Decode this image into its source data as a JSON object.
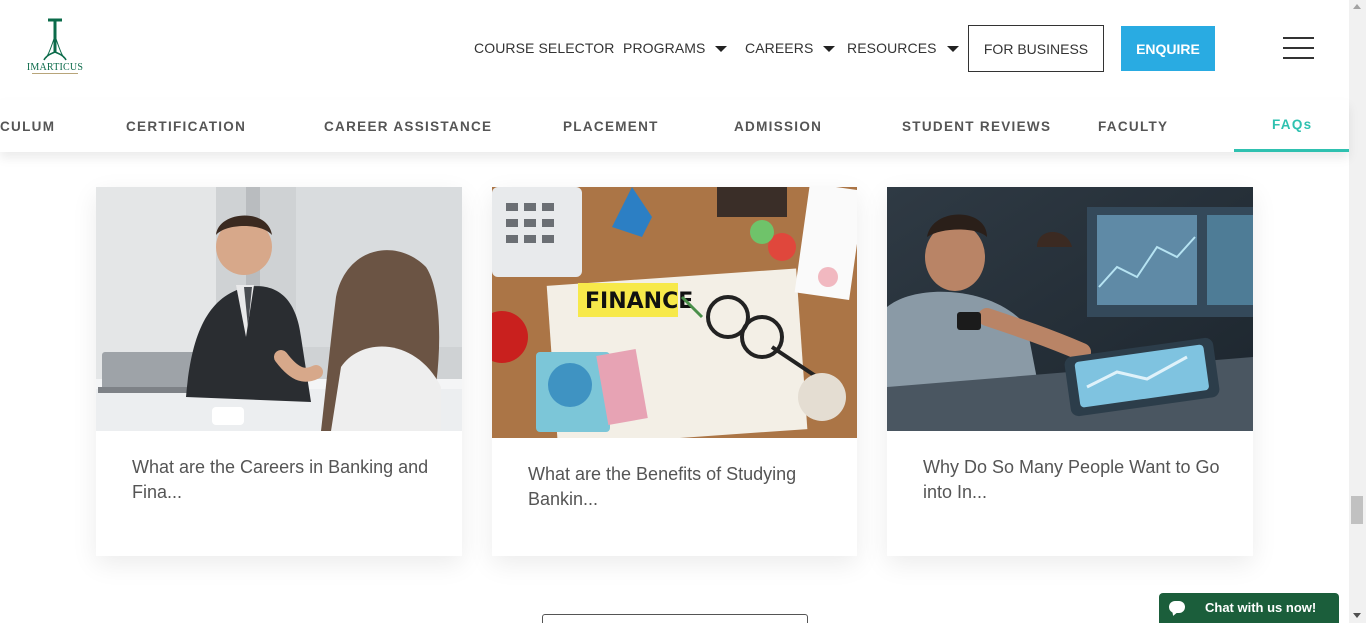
{
  "header": {
    "logo_text": "IMARTICUS",
    "nav": [
      {
        "label": "COURSE SELECTOR",
        "has_caret": false
      },
      {
        "label": "PROGRAMS",
        "has_caret": true
      },
      {
        "label": "CAREERS",
        "has_caret": true
      },
      {
        "label": "RESOURCES",
        "has_caret": true
      }
    ],
    "business_label": "FOR BUSINESS",
    "enquire_label": "ENQUIRE"
  },
  "subnav": {
    "tabs": [
      {
        "label": "CULUM",
        "active": false
      },
      {
        "label": "CERTIFICATION",
        "active": false
      },
      {
        "label": "CAREER ASSISTANCE",
        "active": false
      },
      {
        "label": "PLACEMENT",
        "active": false
      },
      {
        "label": "ADMISSION",
        "active": false
      },
      {
        "label": "STUDENT REVIEWS",
        "active": false
      },
      {
        "label": "FACULTY",
        "active": false
      },
      {
        "label": "FAQs",
        "active": true
      }
    ]
  },
  "articles": [
    {
      "title": "What are the Careers in Banking and Fina...",
      "image": "business-handshake-photo"
    },
    {
      "title": "What are the Benefits of Studying Bankin...",
      "image": "finance-desk-photo",
      "image_label": "FINANCE"
    },
    {
      "title": "Why Do So Many People Want to Go into In...",
      "image": "trader-tablet-photo"
    }
  ],
  "chat": {
    "label": "Chat with us now!"
  },
  "colors": {
    "accent": "#2fc1b0",
    "enquire": "#29abe2",
    "brand_green": "#0b6b4a",
    "chat": "#1b5e3b"
  }
}
